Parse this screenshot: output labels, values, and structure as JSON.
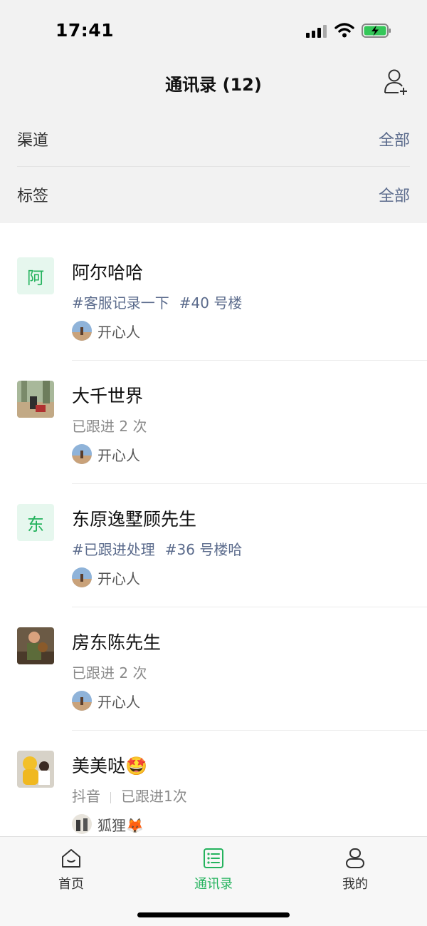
{
  "status_bar": {
    "time": "17:41"
  },
  "header": {
    "title": "通讯录 (12)",
    "add_icon": "add-contact-icon"
  },
  "filters": [
    {
      "label": "渠道",
      "value": "全部"
    },
    {
      "label": "标签",
      "value": "全部"
    }
  ],
  "contacts": [
    {
      "name": "阿尔哈哈",
      "avatar_letter": "阿",
      "tags": [
        "#客服记录一下",
        "#40 号楼"
      ],
      "owner": "开心人"
    },
    {
      "name": "大千世界",
      "status": "已跟进 2 次",
      "owner": "开心人"
    },
    {
      "name": "东原逸墅顾先生",
      "avatar_letter": "东",
      "tags": [
        "#已跟进处理",
        "#36 号楼哈"
      ],
      "owner": "开心人"
    },
    {
      "name": "房东陈先生",
      "status": "已跟进 2 次",
      "owner": "开心人"
    },
    {
      "name": "美美哒🤩",
      "channel": "抖音",
      "status": "已跟进1次",
      "owner": "狐狸🦊"
    }
  ],
  "tabs": [
    {
      "label": "首页",
      "icon": "home-icon",
      "active": false
    },
    {
      "label": "通讯录",
      "icon": "contacts-list-icon",
      "active": true
    },
    {
      "label": "我的",
      "icon": "profile-icon",
      "active": false
    }
  ],
  "colors": {
    "accent": "#25b35e",
    "link": "#5b6b8c",
    "avatar_letter_bg": "#e6f7ee"
  }
}
